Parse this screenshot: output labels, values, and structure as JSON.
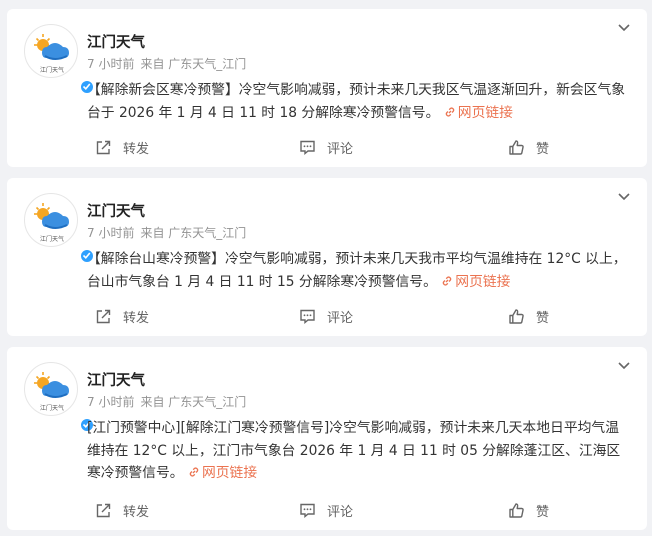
{
  "posts": [
    {
      "author": "江门天气",
      "avatar_text": "江门天气",
      "time": "7 小时前",
      "source": "来自 广东天气_江门",
      "text": "【解除新会区寒冷预警】冷空气影响减弱，预计未来几天我区气温逐渐回升，新会区气象台于 2026 年 1 月 4 日 11 时 18 分解除寒冷预警信号。",
      "link_label": "网页链接",
      "share_label": "转发",
      "comment_label": "评论",
      "like_label": "赞"
    },
    {
      "author": "江门天气",
      "avatar_text": "江门天气",
      "time": "7 小时前",
      "source": "来自 广东天气_江门",
      "text": "【解除台山寒冷预警】冷空气影响减弱，预计未来几天我市平均气温维持在 12°C 以上，台山市气象台 1 月 4 日 11 时 15 分解除寒冷预警信号。",
      "link_label": "网页链接",
      "share_label": "转发",
      "comment_label": "评论",
      "like_label": "赞"
    },
    {
      "author": "江门天气",
      "avatar_text": "江门天气",
      "time": "7 小时前",
      "source": "来自 广东天气_江门",
      "text": "[江门预警中心][解除江门寒冷预警信号]冷空气影响减弱，预计未来几天本地日平均气温维持在 12°C 以上，江门市气象台 2026 年 1 月 4 日 11 时 05 分解除蓬江区、江海区寒冷预警信号。",
      "link_label": "网页链接",
      "share_label": "转发",
      "comment_label": "评论",
      "like_label": "赞"
    }
  ],
  "colors": {
    "link": "#eb7350",
    "verified": "#2ea0ff",
    "meta": "#939393",
    "background": "#f1f2f5"
  },
  "icons": [
    "more-chevron-icon",
    "link-icon",
    "share-icon",
    "comment-icon",
    "like-icon",
    "verified-badge-icon"
  ]
}
